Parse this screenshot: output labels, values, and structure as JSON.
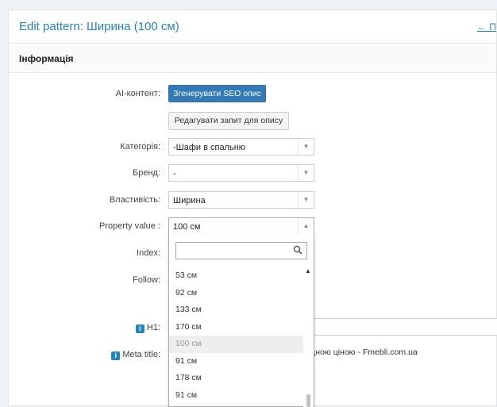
{
  "header": {
    "title": "Edit pattern: Ширина (100 см)",
    "back_link": "← П"
  },
  "section": {
    "title": "Інформація"
  },
  "form": {
    "ai_content_label": "AI-контент:",
    "generate_seo_button": "Згенерувати SEO опис",
    "edit_prompt_button": "Редагувати запит для опису",
    "category_label": "Категорія:",
    "category_value": "-Шафи в спальню",
    "brand_label": "Бренд:",
    "brand_value": "-",
    "property_label": "Властивість:",
    "property_value": "Ширина",
    "property_value_label": "Property value :",
    "property_value_value": "100 см",
    "index_label": "Index:",
    "follow_label": "Follow:",
    "h1_label": "H1:",
    "meta_title_label": "Meta title:",
    "meta_title_visible_text": "тідною ціною - Fmebli.com.ua"
  },
  "dropdown": {
    "search_placeholder": "",
    "options": [
      "53 см",
      "92 см",
      "133 см",
      "170 см",
      "100 см",
      "91 см",
      "178 см",
      "91 см"
    ],
    "selected_index": 4
  },
  "icons": {
    "select_arrow": "chevron-down-icon",
    "select_arrow_open": "chevron-up-icon",
    "search": "search-icon",
    "info": "info-icon"
  },
  "colors": {
    "accent": "#2a82b8",
    "primary_button": "#337ab7",
    "selected_option_bg": "#eeeeee"
  }
}
